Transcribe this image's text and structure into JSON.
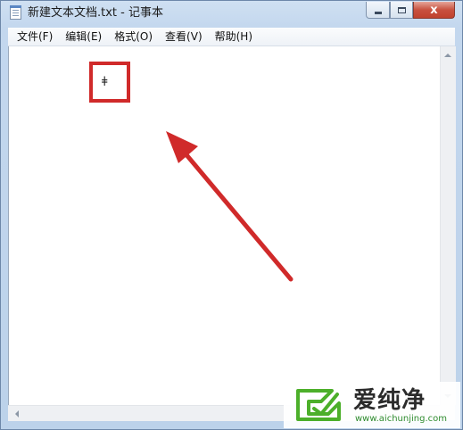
{
  "window": {
    "title": "新建文本文档.txt - 记事本",
    "close_label": "x"
  },
  "menu": {
    "items": [
      {
        "label": "文件(F)"
      },
      {
        "label": "编辑(E)"
      },
      {
        "label": "格式(O)"
      },
      {
        "label": "查看(V)"
      },
      {
        "label": "帮助(H)"
      }
    ]
  },
  "editor": {
    "content": "ǂ"
  },
  "annotation": {
    "highlight_color": "#d02a2a",
    "arrow_color": "#d02a2a"
  },
  "watermark": {
    "brand": "爱纯净",
    "url": "www.aichunjing.com",
    "logo_color": "#4caf2a"
  }
}
